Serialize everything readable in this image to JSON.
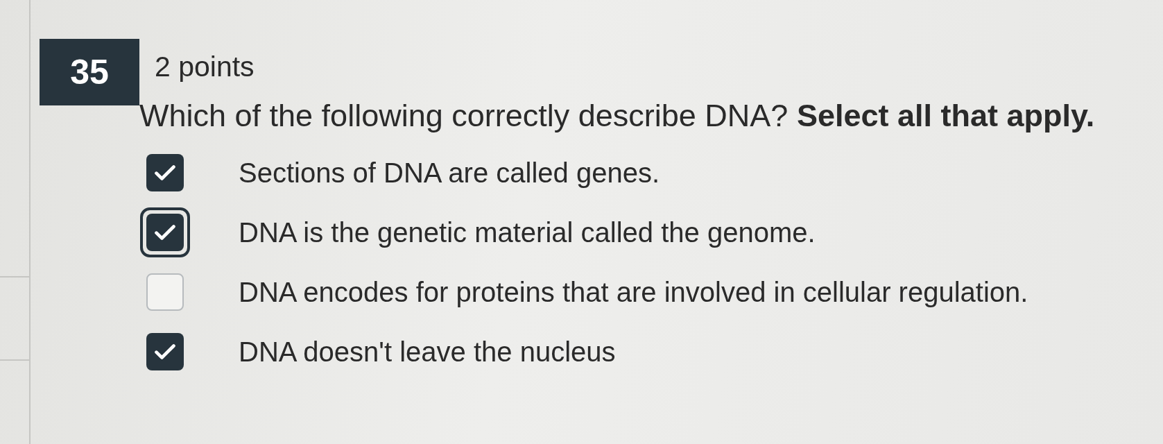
{
  "question": {
    "number": "35",
    "points": "2 points",
    "text": "Which of the following correctly describe DNA? **Select all that apply.**"
  },
  "options": [
    {
      "label": "Sections of DNA are called genes.",
      "checked": true,
      "focused": false
    },
    {
      "label": "DNA is the genetic material called the genome.",
      "checked": true,
      "focused": true
    },
    {
      "label": "DNA encodes for proteins that are involved in cellular regulation.",
      "checked": false,
      "focused": false
    },
    {
      "label": "DNA doesn't leave the nucleus",
      "checked": true,
      "focused": false
    }
  ]
}
